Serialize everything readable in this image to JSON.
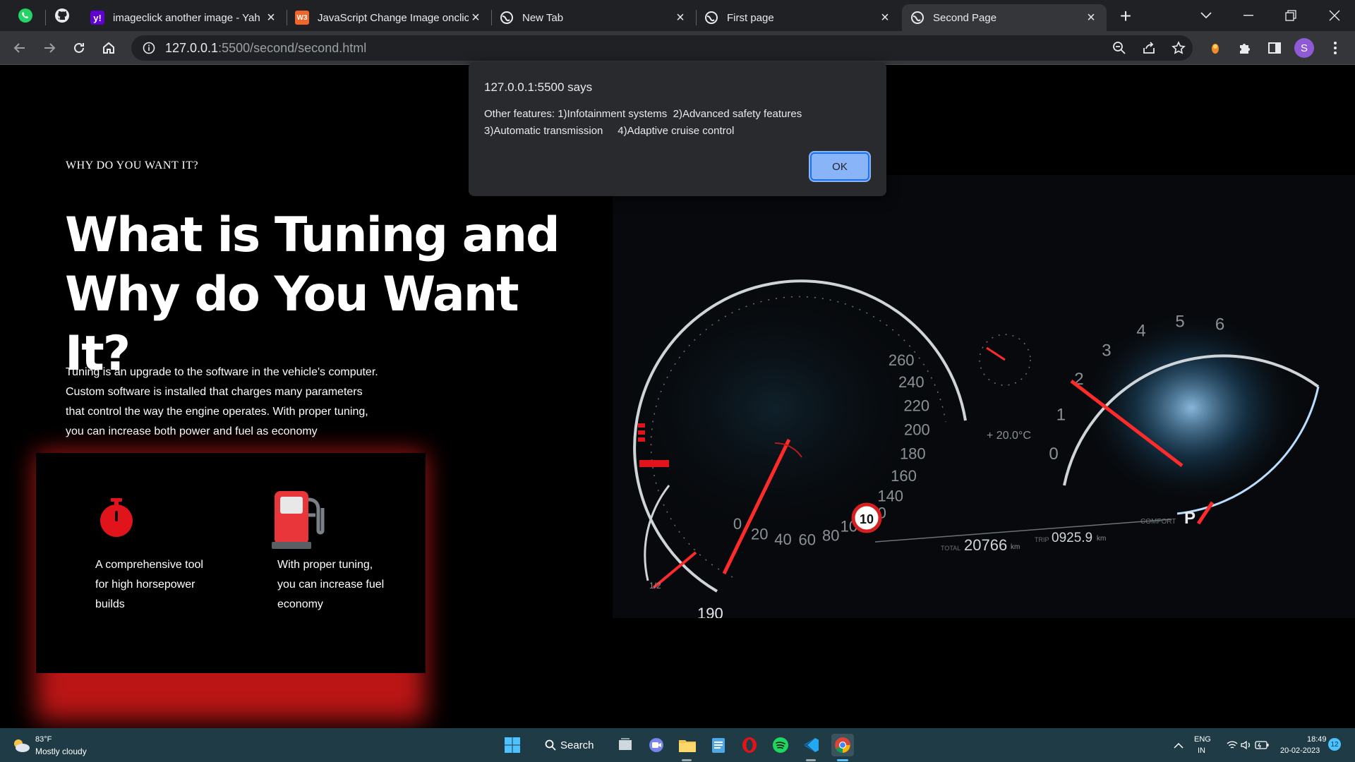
{
  "browser": {
    "tabs": [
      {
        "title": "imageclick another image - Yah",
        "favicon": "yahoo-icon"
      },
      {
        "title": "JavaScript Change Image onclick",
        "favicon": "w3-icon"
      },
      {
        "title": "New Tab",
        "favicon": "globe-icon"
      },
      {
        "title": "First page",
        "favicon": "globe-icon"
      },
      {
        "title": "Second Page",
        "favicon": "globe-icon",
        "active": true
      }
    ],
    "url_host": "127.0.0.1",
    "url_rest": ":5500/second/second.html",
    "profile_initial": "S",
    "profile_color": "#8e5ad6"
  },
  "page": {
    "eyebrow": "WHY DO YOU WANT IT?",
    "headline_line1": "What is Tuning and",
    "headline_line2": "Why do You Want It?",
    "paragraph_lines": [
      "Tuning is an upgrade to the software in the vehicle's computer.",
      "Custom software is installed that charges many parameters",
      "that control the way the engine operates. With proper tuning,",
      "you can increase both power and fuel as economy"
    ],
    "features": [
      {
        "icon": "stopwatch-icon",
        "lines": [
          "A comprehensive tool",
          "for high horsepower",
          "builds"
        ]
      },
      {
        "icon": "fuel-pump-icon",
        "lines": [
          "With proper tuning,",
          "you can increase fuel",
          "economy"
        ]
      }
    ],
    "accent": "#e0141a",
    "dashboard": {
      "speed_ticks": [
        "0",
        "20",
        "40",
        "60",
        "80",
        "100",
        "120",
        "140",
        "160",
        "180",
        "200",
        "220",
        "240",
        "260"
      ],
      "rpm_ticks": [
        "0",
        "1",
        "2",
        "3",
        "4",
        "5",
        "6"
      ],
      "speed_limit": "10",
      "range": "190",
      "range_label": "1/2",
      "temp": "+ 20.0°C",
      "total_label": "TOTAL",
      "odometer": "20766",
      "odometer_unit": "km",
      "trip_label": "TRIP",
      "trip": "0925.9",
      "trip_unit": "km",
      "mode": "COMFORT",
      "gear": "P"
    }
  },
  "alert": {
    "origin": "127.0.0.1:5500 says",
    "message_line1": "Other features: 1)Infotainment systems  2)Advanced safety features",
    "message_line2": "3)Automatic transmission     4)Adaptive cruise control",
    "ok_label": "OK"
  },
  "taskbar": {
    "weather_temp": "83°F",
    "weather_desc": "Mostly cloudy",
    "search_label": "Search",
    "lang": "ENG",
    "region": "IN",
    "time": "18:49",
    "date": "20-02-2023",
    "notification_count": "12"
  }
}
